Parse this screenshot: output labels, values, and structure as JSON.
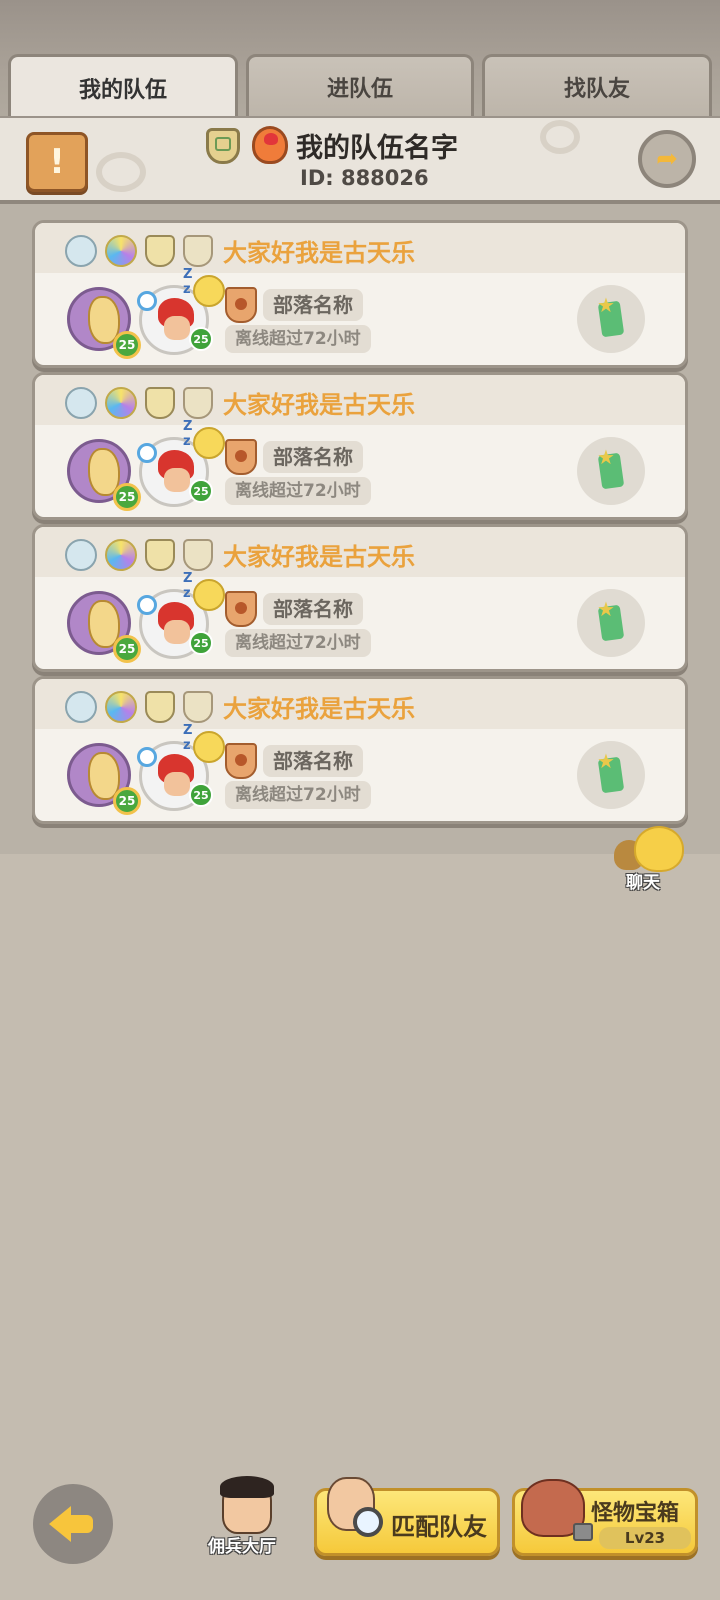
{
  "tabs": [
    {
      "label": "我的队伍",
      "active": true
    },
    {
      "label": "进队伍",
      "active": false
    },
    {
      "label": "找队友",
      "active": false
    }
  ],
  "team": {
    "name": "我的队伍名字",
    "id_label": "ID: 888026"
  },
  "members": [
    {
      "name": "大家好我是古天乐",
      "tribe": "部落名称",
      "status": "离线超过72小时",
      "pet_level": "25",
      "hero_level": "25"
    },
    {
      "name": "大家好我是古天乐",
      "tribe": "部落名称",
      "status": "离线超过72小时",
      "pet_level": "25",
      "hero_level": "25"
    },
    {
      "name": "大家好我是古天乐",
      "tribe": "部落名称",
      "status": "离线超过72小时",
      "pet_level": "25",
      "hero_level": "25"
    },
    {
      "name": "大家好我是古天乐",
      "tribe": "部落名称",
      "status": "离线超过72小时",
      "pet_level": "25",
      "hero_level": "25"
    }
  ],
  "chat": {
    "label": "聊天"
  },
  "bottom": {
    "merc_hall": "佣兵大厅",
    "match": "匹配队友",
    "chest": "怪物宝箱",
    "chest_level": "Lv23"
  },
  "colors": {
    "member_name": "#eaa23d",
    "background": "#c4bcb0",
    "button_yellow": "#f5c93a"
  }
}
